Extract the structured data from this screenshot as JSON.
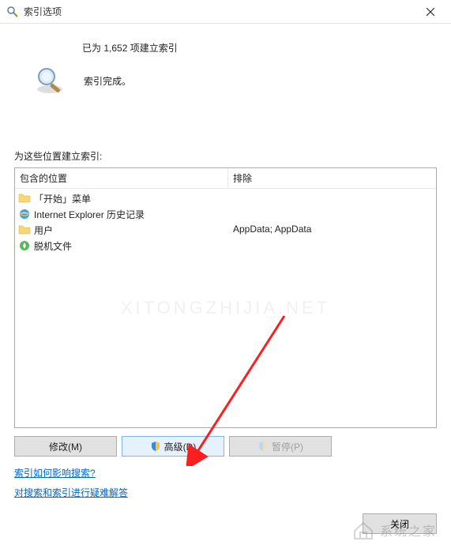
{
  "title": "索引选项",
  "status_text": "已为 1,652 项建立索引",
  "status_done": "索引完成。",
  "section_label": "为这些位置建立索引:",
  "columns": {
    "included": "包含的位置",
    "excluded": "排除"
  },
  "locations": [
    {
      "label": "「开始」菜单",
      "icon": "folder"
    },
    {
      "label": "Internet Explorer 历史记录",
      "icon": "ie"
    },
    {
      "label": "用户",
      "icon": "folder"
    },
    {
      "label": "脱机文件",
      "icon": "offline"
    }
  ],
  "exclusions_display": "AppData; AppData",
  "buttons": {
    "modify": "修改(M)",
    "advanced": "高级(D)",
    "pause": "暂停(P)",
    "close": "关闭"
  },
  "links": {
    "how_affects": "索引如何影响搜索?",
    "troubleshoot": "对搜索和索引进行疑难解答"
  },
  "watermark_center": "XITONGZHIJIA.NET",
  "watermark_corner": "系统之家"
}
